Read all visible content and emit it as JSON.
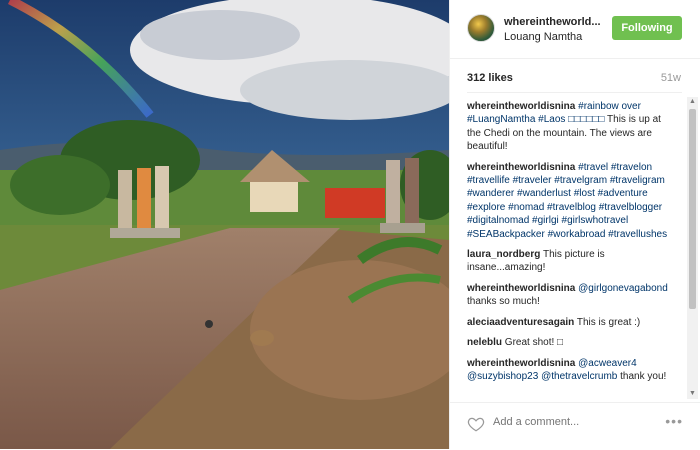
{
  "post": {
    "username": "whereintheworld...",
    "location": "Louang Namtha",
    "follow_label": "Following",
    "likes": "312 likes",
    "time": "51w",
    "add_comment_placeholder": "Add a comment...",
    "more_label": "•••",
    "scroll_up": "▲",
    "scroll_down": "▼"
  },
  "comments": [
    {
      "user": "whereintheworldisnina",
      "tags": "#rainbow over #LuangNamtha #Laos □□□□□□",
      "text": " This is up at the Chedi on the mountain. The views are beautiful!"
    },
    {
      "user": "whereintheworldisnina",
      "tags": "#travel #travelon #travellife #traveler #travelgram #traveligram #wanderer #wanderlust #lost #adventure #explore #nomad #travelblog #travelblogger #digitalnomad #girlgi #girlswhotravel #SEABackpacker #workabroad #travellushes",
      "text": ""
    },
    {
      "user": "laura_nordberg",
      "tags": "",
      "text": " This picture is insane...amazing!"
    },
    {
      "user": "whereintheworldisnina",
      "tags": "@girlgonevagabond",
      "text": " thanks so much!"
    },
    {
      "user": "aleciaadventuresagain",
      "tags": "",
      "text": " This is great :)"
    },
    {
      "user": "neleblu",
      "tags": "",
      "text": " Great shot! □"
    },
    {
      "user": "whereintheworldisnina",
      "tags": "@acweaver4 @suzybishop23 @thetravelcrumb",
      "text": " thank you!"
    }
  ],
  "colors": {
    "follow_bg": "#70c050",
    "tag": "#003569"
  },
  "icons": {
    "heart": "heart-icon",
    "avatar": "avatar"
  }
}
